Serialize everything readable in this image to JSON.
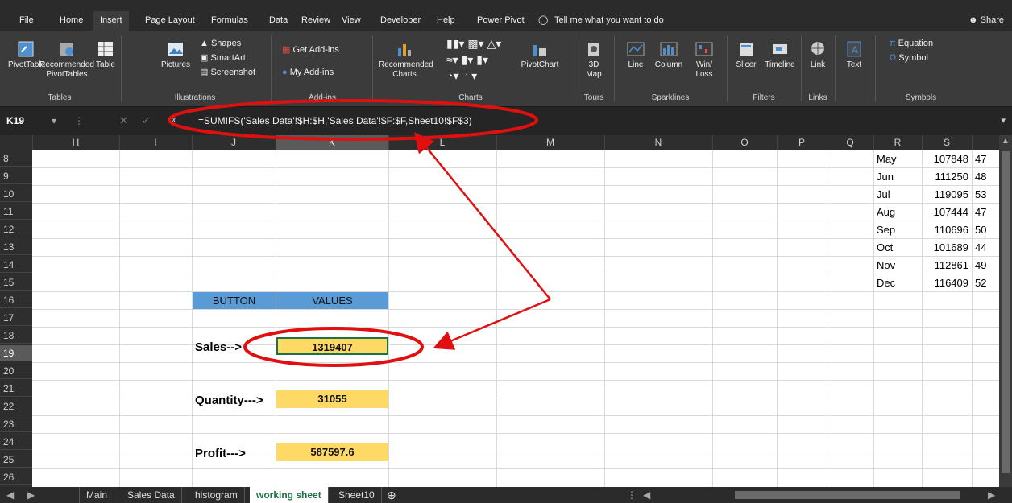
{
  "ribbon": {
    "tabs": [
      "File",
      "Home",
      "Insert",
      "Page Layout",
      "Formulas",
      "Data",
      "Review",
      "View",
      "Developer",
      "Help",
      "Power Pivot"
    ],
    "active_tab": "Insert",
    "tell_me": "Tell me what you want to do",
    "share": "Share",
    "groups": {
      "tables": {
        "label": "Tables",
        "pivot": "PivotTable",
        "recommended": "Recommended",
        "recommended2": "PivotTables",
        "table": "Table"
      },
      "illustrations": {
        "label": "Illustrations",
        "pictures": "Pictures",
        "shapes": "Shapes",
        "smartart": "SmartArt",
        "screenshot": "Screenshot"
      },
      "addins": {
        "label": "Add-ins",
        "get": "Get Add-ins",
        "my": "My Add-ins"
      },
      "charts": {
        "label": "Charts",
        "recommended": "Recommended",
        "recommended2": "Charts",
        "pivotchart": "PivotChart"
      },
      "tours": {
        "label": "Tours",
        "map": "3D",
        "map2": "Map"
      },
      "sparklines": {
        "label": "Sparklines",
        "line": "Line",
        "column": "Column",
        "winloss": "Win/",
        "winloss2": "Loss"
      },
      "filters": {
        "label": "Filters",
        "slicer": "Slicer",
        "timeline": "Timeline"
      },
      "links": {
        "label": "Links",
        "link": "Link"
      },
      "text": {
        "label": "Text"
      },
      "symbols": {
        "label": "Symbols",
        "equation": "Equation",
        "symbol": "Symbol"
      }
    }
  },
  "formula_bar": {
    "name_box": "K19",
    "fx": "fx",
    "formula": "=SUMIFS('Sales Data'!$H:$H,'Sales Data'!$F:$F,Sheet10!$F$3)"
  },
  "columns": [
    "H",
    "I",
    "J",
    "K",
    "L",
    "M",
    "N",
    "O",
    "P",
    "Q",
    "R",
    "S"
  ],
  "rows": [
    "8",
    "9",
    "10",
    "11",
    "12",
    "13",
    "14",
    "15",
    "16",
    "17",
    "18",
    "19",
    "20",
    "21",
    "22",
    "23",
    "24",
    "25",
    "26"
  ],
  "month_table": [
    {
      "month": "May",
      "value": "107848",
      "next": "47"
    },
    {
      "month": "Jun",
      "value": "111250",
      "next": "48"
    },
    {
      "month": "Jul",
      "value": "119095",
      "next": "53"
    },
    {
      "month": "Aug",
      "value": "107444",
      "next": "47"
    },
    {
      "month": "Sep",
      "value": "110696",
      "next": "50"
    },
    {
      "month": "Oct",
      "value": "101689",
      "next": "44"
    },
    {
      "month": "Nov",
      "value": "112861",
      "next": "49"
    },
    {
      "month": "Dec",
      "value": "116409",
      "next": "52"
    }
  ],
  "summary": {
    "header_button": "BUTTON",
    "header_values": "VALUES",
    "sales_label": "Sales-->",
    "sales_value": "1319407",
    "quantity_label": "Quantity--->",
    "quantity_value": "31055",
    "profit_label": "Profit--->",
    "profit_value": "587597.6"
  },
  "sheet_tabs": [
    "Main",
    "Sales Data",
    "histogram",
    "working sheet",
    "Sheet10"
  ],
  "active_sheet": "working sheet",
  "colors": {
    "highlight": "#ffd966",
    "header": "#5b9bd5",
    "annotation": "#e01010",
    "active_tab": "#7dc383"
  }
}
